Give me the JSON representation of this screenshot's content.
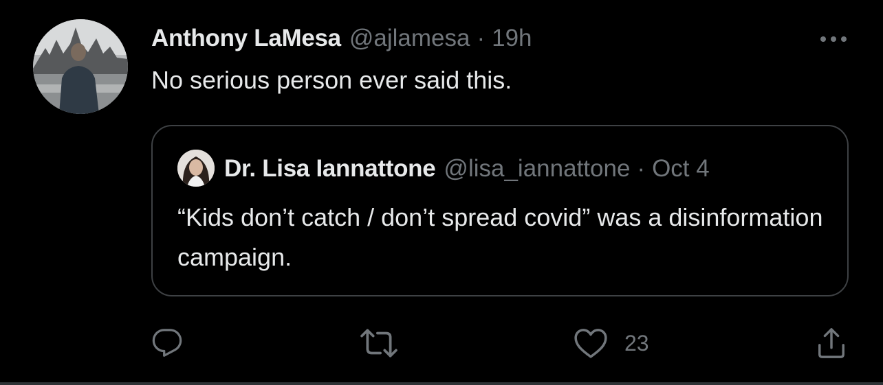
{
  "tweet": {
    "author_name": "Anthony LaMesa",
    "author_handle": "@ajlamesa",
    "separator": "·",
    "timestamp": "19h",
    "text": "No serious person ever said this."
  },
  "quoted": {
    "author_name": "Dr. Lisa Iannattone",
    "author_handle": "@lisa_iannattone",
    "separator": "·",
    "timestamp": "Oct 4",
    "text": "“Kids don’t catch / don’t spread covid” was a disinformation campaign."
  },
  "actions": {
    "reply_icon": "reply-icon",
    "retweet_icon": "retweet-icon",
    "like_icon": "heart-icon",
    "like_count": "23",
    "share_icon": "share-icon"
  },
  "more_icon": "more-horizontal-icon",
  "colors": {
    "background": "#000000",
    "primary_text": "#e7e9ea",
    "secondary_text": "#71767b",
    "border": "#3e4144"
  }
}
